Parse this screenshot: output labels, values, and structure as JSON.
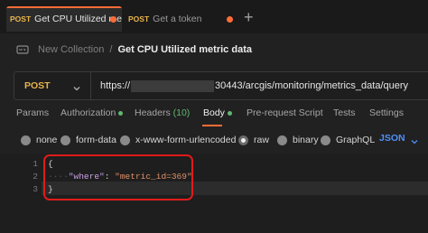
{
  "tabs": [
    {
      "method": "POST",
      "name": "Get CPU Utilized metr",
      "unsaved": true
    },
    {
      "method": "POST",
      "name": "Get a token",
      "unsaved": true
    }
  ],
  "new_tab_label": "+",
  "breadcrumb": {
    "parent": "New Collection",
    "separator": "/",
    "current": "Get CPU Utilized metric data"
  },
  "request": {
    "method": "POST",
    "url_prefix": "https://",
    "url_suffix": "30443/arcgis/monitoring/metrics_data/query"
  },
  "request_tabs": {
    "params": "Params",
    "authorization": "Authorization",
    "headers": "Headers",
    "headers_count": "(10)",
    "body": "Body",
    "pre_request": "Pre-request Script",
    "tests": "Tests",
    "settings": "Settings",
    "active": "Body"
  },
  "body_types": {
    "none": "none",
    "form_data": "form-data",
    "urlencoded": "x-www-form-urlencoded",
    "raw": "raw",
    "binary": "binary",
    "graphql": "GraphQL",
    "selected": "raw"
  },
  "format": "JSON",
  "editor": {
    "line_numbers": [
      "1",
      "2",
      "3"
    ],
    "open_brace": "{",
    "indent": "····",
    "key": "\"where\"",
    "colon": ": ",
    "value": "\"metric_id=369\"",
    "close_brace": "}"
  },
  "colors": {
    "accent": "#ff6c37",
    "method": "#e8b34b",
    "link": "#4f8ff7",
    "highlight_box": "#e11b1b"
  }
}
